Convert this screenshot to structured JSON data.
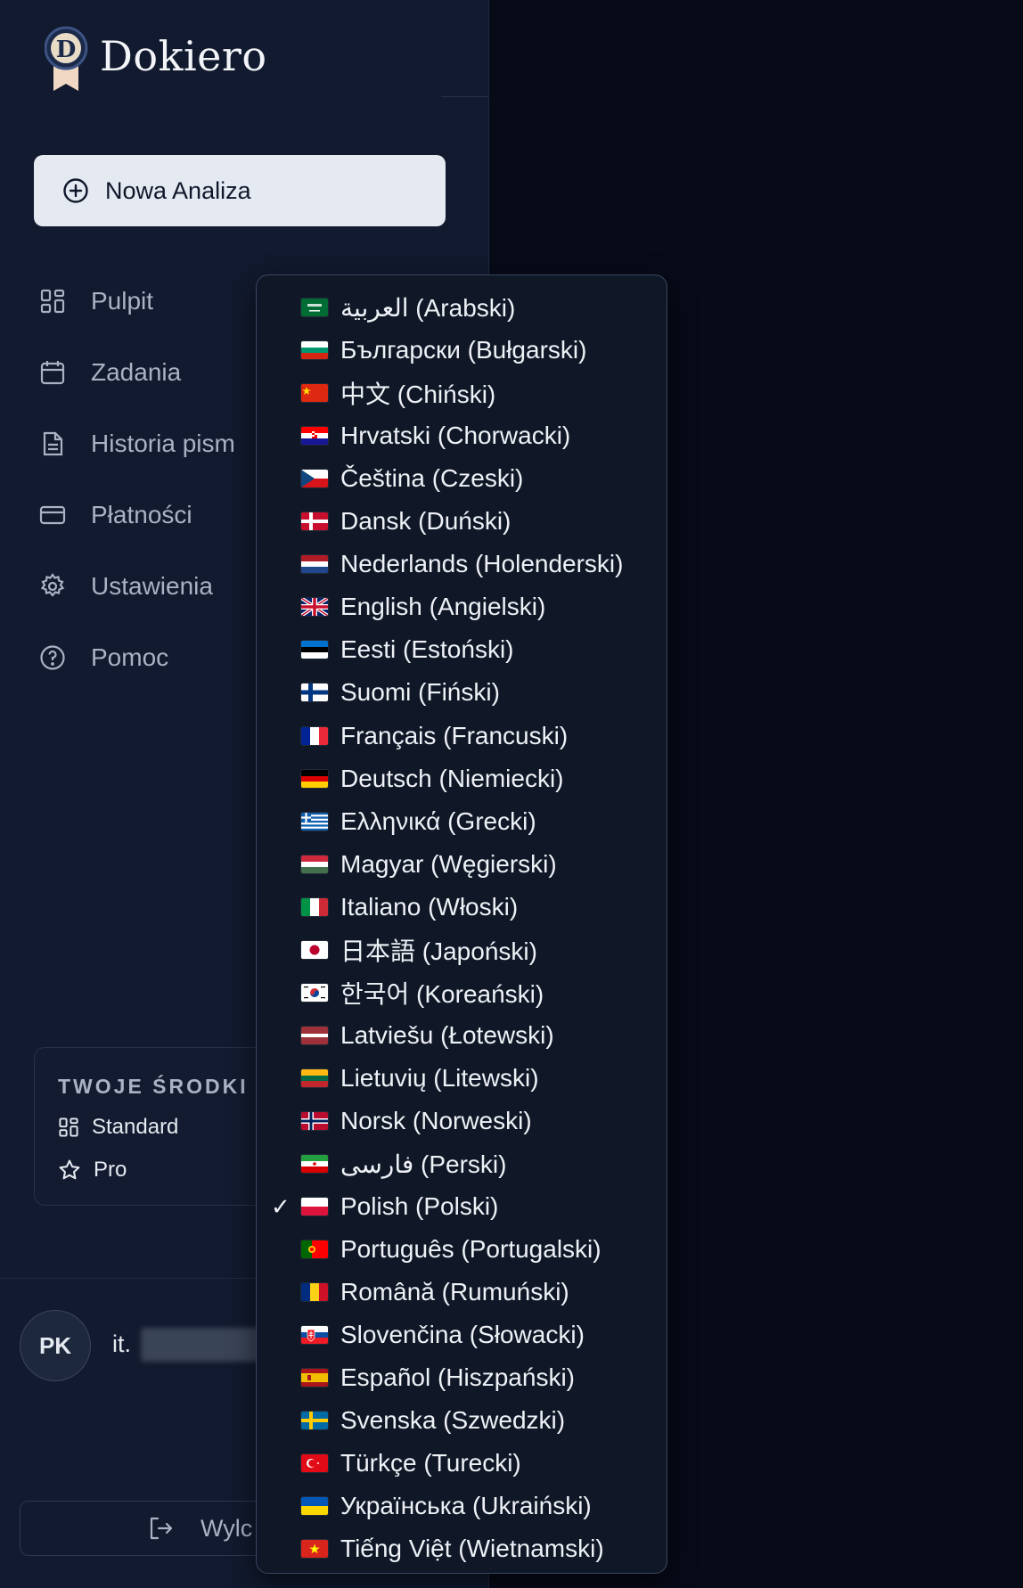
{
  "app": {
    "name": "Dokiero",
    "logo_letter": "D"
  },
  "new_analysis": {
    "label": "Nowa Analiza"
  },
  "nav": [
    {
      "label": "Pulpit",
      "icon": "grid-icon"
    },
    {
      "label": "Zadania",
      "icon": "calendar-icon"
    },
    {
      "label": "Historia pism",
      "icon": "document-icon"
    },
    {
      "label": "Płatności",
      "icon": "credit-card-icon"
    },
    {
      "label": "Ustawienia",
      "icon": "gear-icon"
    },
    {
      "label": "Pomoc",
      "icon": "help-circle-icon"
    }
  ],
  "funds": {
    "title": "TWOJE ŚRODKI",
    "items": [
      {
        "label": "Standard",
        "icon": "grid-icon"
      },
      {
        "label": "Pro",
        "icon": "star-icon"
      }
    ]
  },
  "user": {
    "initials": "PK",
    "email_prefix": "it."
  },
  "logout": {
    "label": "Wylc"
  },
  "language_menu": {
    "selected": "Polish (Polski)",
    "items": [
      {
        "label": "العربية (Arabski)",
        "flag": "sa",
        "checked": false
      },
      {
        "label": "Български (Bułgarski)",
        "flag": "bg",
        "checked": false
      },
      {
        "label": "中文 (Chiński)",
        "flag": "cn",
        "checked": false
      },
      {
        "label": "Hrvatski (Chorwacki)",
        "flag": "hr",
        "checked": false
      },
      {
        "label": "Čeština (Czeski)",
        "flag": "cz",
        "checked": false
      },
      {
        "label": "Dansk (Duński)",
        "flag": "dk",
        "checked": false
      },
      {
        "label": "Nederlands (Holenderski)",
        "flag": "nl",
        "checked": false
      },
      {
        "label": "English (Angielski)",
        "flag": "gb",
        "checked": false
      },
      {
        "label": "Eesti (Estoński)",
        "flag": "ee",
        "checked": false
      },
      {
        "label": "Suomi (Fiński)",
        "flag": "fi",
        "checked": false
      },
      {
        "label": "Français (Francuski)",
        "flag": "fr",
        "checked": false
      },
      {
        "label": "Deutsch (Niemiecki)",
        "flag": "de",
        "checked": false
      },
      {
        "label": "Ελληνικά (Grecki)",
        "flag": "gr",
        "checked": false
      },
      {
        "label": "Magyar (Węgierski)",
        "flag": "hu",
        "checked": false
      },
      {
        "label": "Italiano (Włoski)",
        "flag": "it",
        "checked": false
      },
      {
        "label": "日本語 (Japoński)",
        "flag": "jp",
        "checked": false
      },
      {
        "label": "한국어 (Koreański)",
        "flag": "kr",
        "checked": false
      },
      {
        "label": "Latviešu (Łotewski)",
        "flag": "lv",
        "checked": false
      },
      {
        "label": "Lietuvių (Litewski)",
        "flag": "lt",
        "checked": false
      },
      {
        "label": "Norsk (Norweski)",
        "flag": "no",
        "checked": false
      },
      {
        "label": "فارسی (Perski)",
        "flag": "ir",
        "checked": false
      },
      {
        "label": "Polish (Polski)",
        "flag": "pl",
        "checked": true
      },
      {
        "label": "Português (Portugalski)",
        "flag": "pt",
        "checked": false
      },
      {
        "label": "Română (Rumuński)",
        "flag": "ro",
        "checked": false
      },
      {
        "label": "Slovenčina (Słowacki)",
        "flag": "sk",
        "checked": false
      },
      {
        "label": "Español (Hiszpański)",
        "flag": "es",
        "checked": false
      },
      {
        "label": "Svenska (Szwedzki)",
        "flag": "se",
        "checked": false
      },
      {
        "label": "Türkçe (Turecki)",
        "flag": "tr",
        "checked": false
      },
      {
        "label": "Українська (Ukraiński)",
        "flag": "ua",
        "checked": false
      },
      {
        "label": "Tiếng Việt (Wietnamski)",
        "flag": "vn",
        "checked": false
      }
    ],
    "check_glyph": "✓"
  },
  "colors": {
    "background": "#070b18",
    "sidebar": "#111a2e",
    "button_bg": "#e5e9f2",
    "muted_text": "#aab3c5"
  }
}
